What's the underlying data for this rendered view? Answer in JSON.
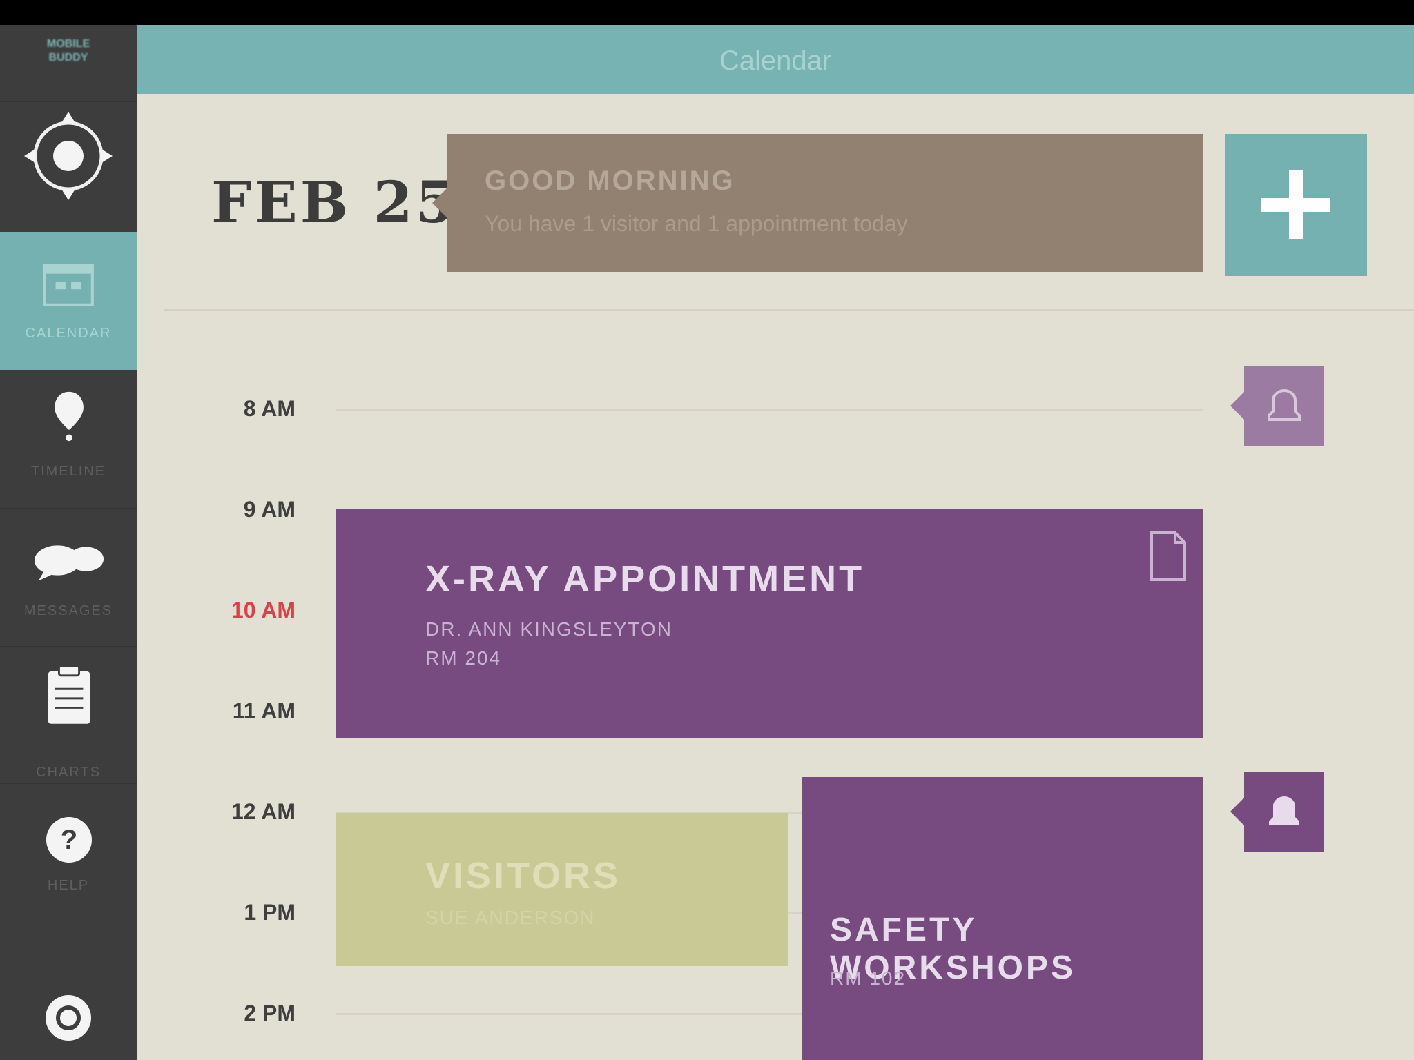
{
  "header": {
    "title": "Calendar"
  },
  "sidebar": {
    "brand": "MOBILE\nBUDDY",
    "items": [
      {
        "label": "Calendar",
        "icon": "calendar-icon",
        "active": true
      },
      {
        "label": "Timeline",
        "icon": "location-pin-icon"
      },
      {
        "label": "Messages",
        "icon": "chat-bubble-icon"
      },
      {
        "label": "Charts",
        "icon": "clipboard-icon"
      },
      {
        "label": "Help",
        "icon": "help-icon"
      },
      {
        "label": "",
        "icon": "power-icon"
      }
    ]
  },
  "date": {
    "label": "FEB 25"
  },
  "greeting": {
    "title": "GOOD MORNING",
    "subtitle": "You have 1 visitor and 1 appointment today"
  },
  "timeline": {
    "times": [
      "8 AM",
      "9 AM",
      "10 AM",
      "11 AM",
      "12 AM",
      "1 PM",
      "2 PM"
    ],
    "current": "10 AM"
  },
  "events": {
    "xray": {
      "title": "X-RAY APPOINTMENT",
      "line1": "DR. ANN KINGSLEYTON",
      "line2": "RM 204"
    },
    "visitors": {
      "title": "VISITORS",
      "subtitle": "SUE ANDERSON"
    },
    "safety": {
      "title": "SAFETY WORKSHOPS",
      "subtitle": "RM 102"
    }
  },
  "colors": {
    "teal": "#75b1b1",
    "purple": "#774a80",
    "olive": "#c9c996",
    "brown": "#928170",
    "background": "#e2e0d2",
    "sidebar": "#3d3d3d",
    "now_marker": "#d9424b"
  }
}
